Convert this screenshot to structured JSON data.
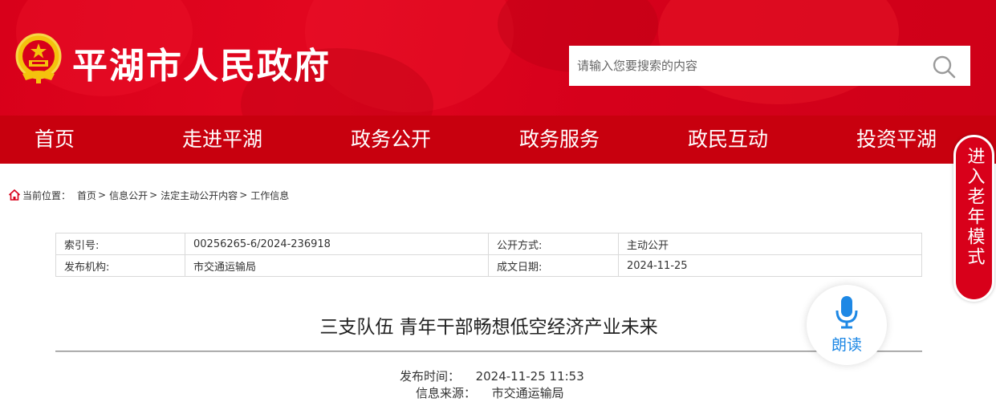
{
  "header": {
    "site_title": "平湖市人民政府",
    "search_placeholder": "请输入您要搜索的内容",
    "brand_color": "#d8001a",
    "search_icon": "search-icon",
    "emblem_icon": "national-emblem-icon"
  },
  "nav": {
    "items": [
      {
        "label": "首页"
      },
      {
        "label": "走进平湖"
      },
      {
        "label": "政务公开"
      },
      {
        "label": "政务服务"
      },
      {
        "label": "政民互动"
      },
      {
        "label": "投资平湖"
      }
    ],
    "background_color": "#c8000e"
  },
  "elder_mode": {
    "label": "进入老年模式"
  },
  "breadcrumb": {
    "prefix": "当前位置：",
    "items": [
      "首页",
      "信息公开",
      "法定主动公开内容",
      "工作信息"
    ],
    "separator": ">"
  },
  "meta": {
    "index_label": "索引号:",
    "index_value": "00256265-6/2024-236918",
    "open_method_label": "公开方式:",
    "open_method_value": "主动公开",
    "publisher_label": "发布机构:",
    "publisher_value": "市交通运输局",
    "date_label": "成文日期:",
    "date_value": "2024-11-25"
  },
  "article": {
    "title": "三支队伍 青年干部畅想低空经济产业未来",
    "publish_time_label": "发布时间：",
    "publish_time_value": "2024-11-25 11:53",
    "source_label": "信息来源：",
    "source_value": "市交通运输局"
  },
  "read_aloud": {
    "label": "朗读",
    "color": "#1e88e5",
    "icon": "microphone-icon"
  }
}
